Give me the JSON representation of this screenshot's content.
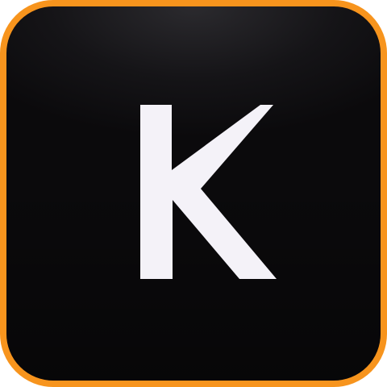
{
  "icon": {
    "letter": "K",
    "letter_color": "#f4f2f8",
    "border_color": "#f7941d",
    "background_color": "#0f0e11"
  }
}
